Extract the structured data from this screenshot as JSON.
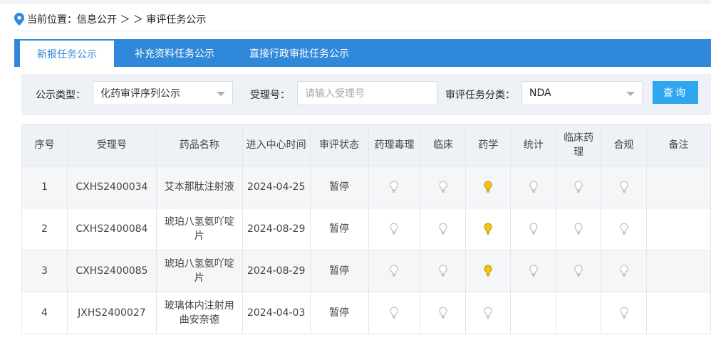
{
  "breadcrumb": {
    "text": "当前位置：信息公开 ＞ ＞ 审评任务公示"
  },
  "tabs": [
    {
      "label": "新报任务公示",
      "active": true
    },
    {
      "label": "补充资料任务公示",
      "active": false
    },
    {
      "label": "直接行政审批任务公示",
      "active": false
    }
  ],
  "filter": {
    "type_label": "公示类型：",
    "type_value": "化药审评序列公示",
    "accept_label": "受理号：",
    "accept_placeholder": "请输入受理号",
    "category_label": "审评任务分类：",
    "category_value": "NDA",
    "query_button": "查询"
  },
  "table": {
    "headers": [
      "序号",
      "受理号",
      "药品名称",
      "进入中心时间",
      "审评状态",
      "药理毒理",
      "临床",
      "药学",
      "统计",
      "临床药理",
      "合规",
      "备注"
    ],
    "rows": [
      {
        "no": "1",
        "accept_no": "CXHS2400034",
        "drug": "艾本那肽注射液",
        "date": "2024-04-25",
        "status": "暂停",
        "tox": "off",
        "clinical": "off",
        "pharmacy": "on",
        "stats": "off",
        "clin_pharm": "off",
        "compliance": "off",
        "remark": ""
      },
      {
        "no": "2",
        "accept_no": "CXHS2400084",
        "drug": "琥珀八氢氨吖啶片",
        "date": "2024-08-29",
        "status": "暂停",
        "tox": "off",
        "clinical": "off",
        "pharmacy": "on",
        "stats": "off",
        "clin_pharm": "off",
        "compliance": "off",
        "remark": ""
      },
      {
        "no": "3",
        "accept_no": "CXHS2400085",
        "drug": "琥珀八氢氨吖啶片",
        "date": "2024-08-29",
        "status": "暂停",
        "tox": "off",
        "clinical": "off",
        "pharmacy": "on",
        "stats": "off",
        "clin_pharm": "off",
        "compliance": "off",
        "remark": ""
      },
      {
        "no": "4",
        "accept_no": "JXHS2400027",
        "drug": "玻璃体内注射用曲安奈德",
        "date": "2024-04-03",
        "status": "暂停",
        "tox": "off",
        "clinical": "off",
        "pharmacy": "off",
        "stats": "",
        "clin_pharm": "",
        "compliance": "off",
        "remark": ""
      }
    ]
  },
  "icons": {
    "bulb_on": "bulb-on-icon",
    "bulb_off": "bulb-off-icon",
    "location": "location-pin-icon"
  },
  "colors": {
    "accent": "#2f88d9",
    "button": "#2fa6f0",
    "bulb_on": "#f0c419",
    "bulb_off": "#b8b8b8"
  }
}
